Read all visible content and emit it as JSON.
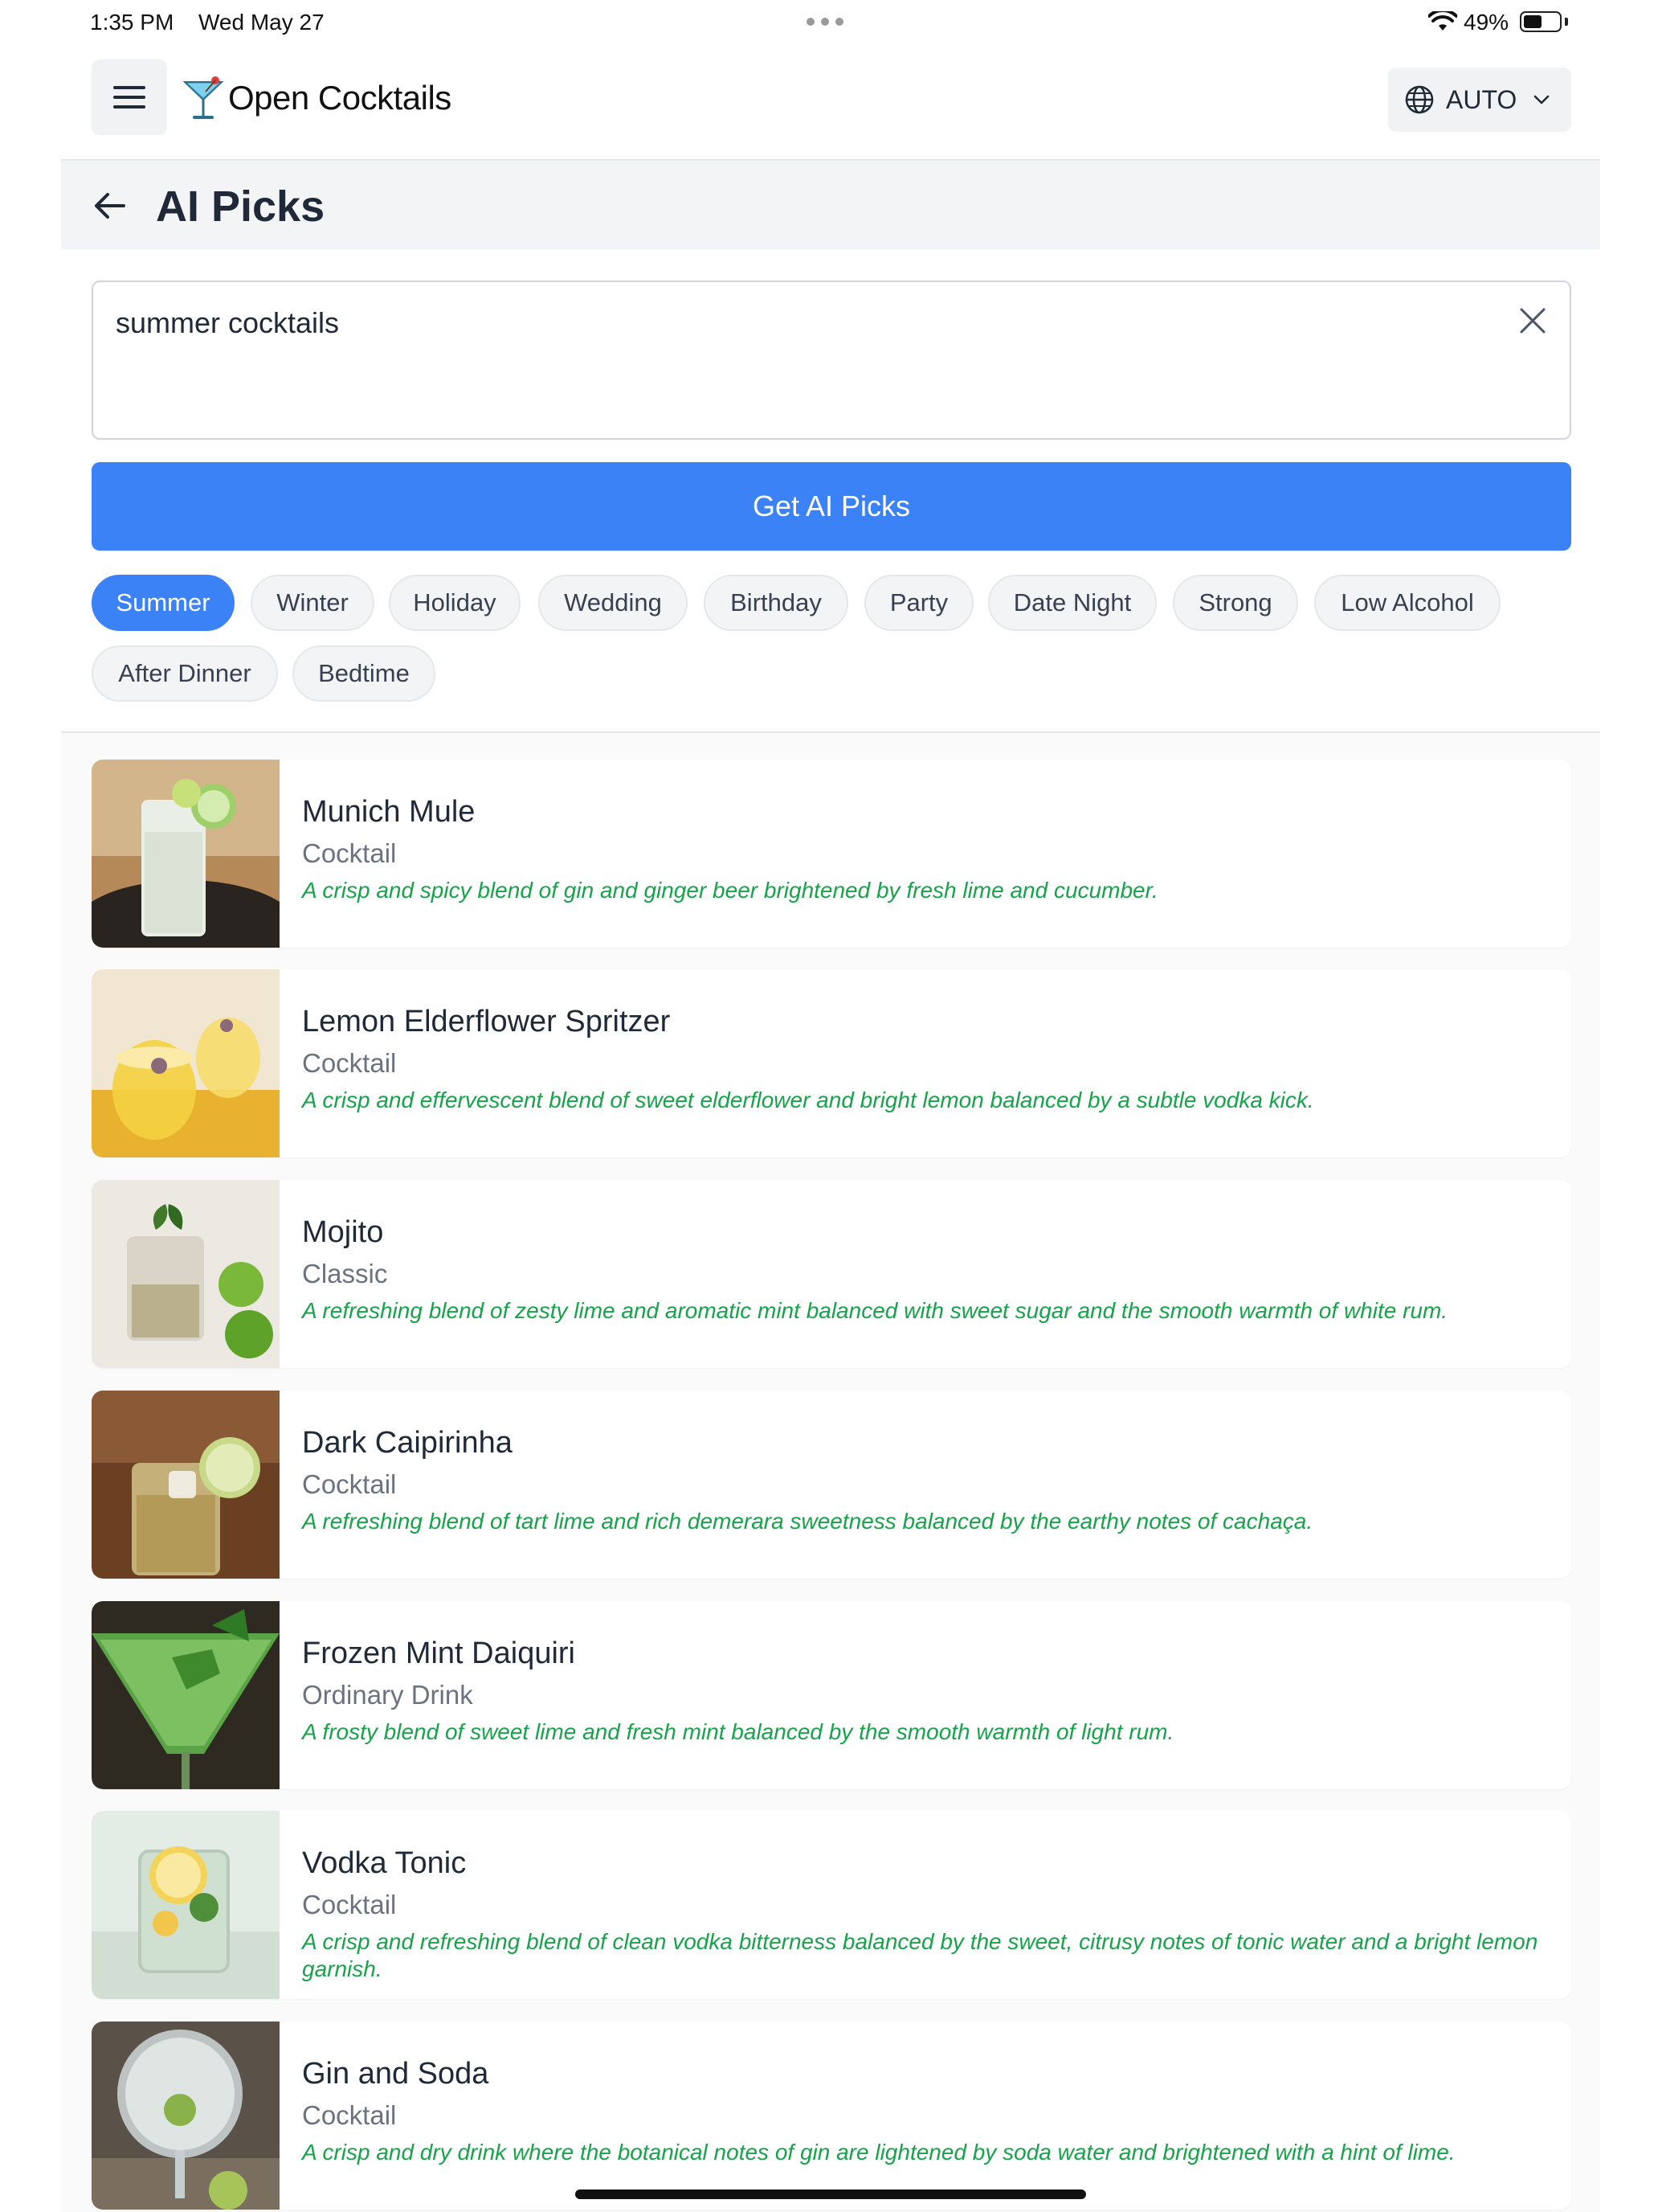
{
  "status_bar": {
    "time": "1:35 PM",
    "date": "Wed May 27",
    "battery_pct": "49%",
    "battery_level": 0.49
  },
  "app": {
    "title": "Open Cocktails",
    "language_label": "AUTO"
  },
  "page": {
    "title": "AI Picks"
  },
  "search": {
    "value": "summer cocktails"
  },
  "primary_button": {
    "label": "Get AI Picks"
  },
  "chips": [
    {
      "label": "Summer",
      "active": true
    },
    {
      "label": "Winter",
      "active": false
    },
    {
      "label": "Holiday",
      "active": false
    },
    {
      "label": "Wedding",
      "active": false
    },
    {
      "label": "Birthday",
      "active": false
    },
    {
      "label": "Party",
      "active": false
    },
    {
      "label": "Date Night",
      "active": false
    },
    {
      "label": "Strong",
      "active": false
    },
    {
      "label": "Low Alcohol",
      "active": false
    },
    {
      "label": "After Dinner",
      "active": false
    },
    {
      "label": "Bedtime",
      "active": false
    }
  ],
  "results": [
    {
      "name": "Munich Mule",
      "category": "Cocktail",
      "description": "A crisp and spicy blend of gin and ginger beer brightened by fresh lime and cucumber."
    },
    {
      "name": "Lemon Elderflower Spritzer",
      "category": "Cocktail",
      "description": "A crisp and effervescent blend of sweet elderflower and bright lemon balanced by a subtle vodka kick."
    },
    {
      "name": "Mojito",
      "category": "Classic",
      "description": "A refreshing blend of zesty lime and aromatic mint balanced with sweet sugar and the smooth warmth of white rum."
    },
    {
      "name": "Dark Caipirinha",
      "category": "Cocktail",
      "description": "A refreshing blend of tart lime and rich demerara sweetness balanced by the earthy notes of cachaça."
    },
    {
      "name": "Frozen Mint Daiquiri",
      "category": "Ordinary Drink",
      "description": "A frosty blend of sweet lime and fresh mint balanced by the smooth warmth of light rum."
    },
    {
      "name": "Vodka Tonic",
      "category": "Cocktail",
      "description": "A crisp and refreshing blend of clean vodka bitterness balanced by the sweet, citrusy notes of tonic water and a bright lemon garnish."
    },
    {
      "name": "Gin and Soda",
      "category": "Cocktail",
      "description": "A crisp and dry drink where the botanical notes of gin are lightened by soda water and brightened with a hint of lime."
    }
  ],
  "colors": {
    "accent": "#3b82f6",
    "description_text": "#16a34a"
  }
}
